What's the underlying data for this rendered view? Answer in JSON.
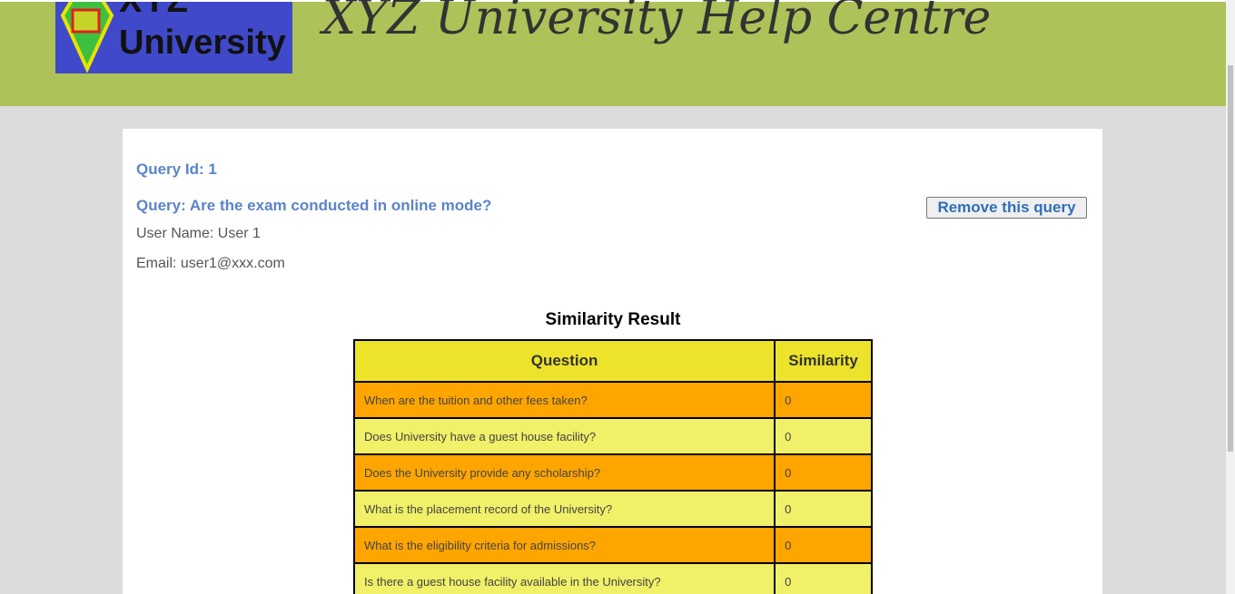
{
  "header": {
    "logo_top_text": "XYZ",
    "logo_text": "University",
    "site_title": "XYZ University Help Centre",
    "background_color": "#adc259"
  },
  "query": {
    "id_text": "Query Id: 1",
    "query_text": "Query: Are the exam conducted in online mode?",
    "user_name_text": "User Name: User 1",
    "email_text": "Email: user1@xxx.com",
    "remove_button_label": "Remove this query"
  },
  "similarity": {
    "title": "Similarity Result",
    "headers": [
      "Question",
      "Similarity"
    ],
    "rows": [
      {
        "question": "When are the tuition and other fees taken?",
        "similarity": "0",
        "color": "#ffa500"
      },
      {
        "question": "Does University have a guest house facility?",
        "similarity": "0",
        "color": "#f0f069"
      },
      {
        "question": "Does the University provide any scholarship?",
        "similarity": "0",
        "color": "#ffa500"
      },
      {
        "question": "What is the placement record of the University?",
        "similarity": "0",
        "color": "#f0f069"
      },
      {
        "question": "What is the eligibility criteria for admissions?",
        "similarity": "0",
        "color": "#ffa500"
      },
      {
        "question": "Is there a guest house facility available in the University?",
        "similarity": "0",
        "color": "#f0f069"
      }
    ]
  }
}
